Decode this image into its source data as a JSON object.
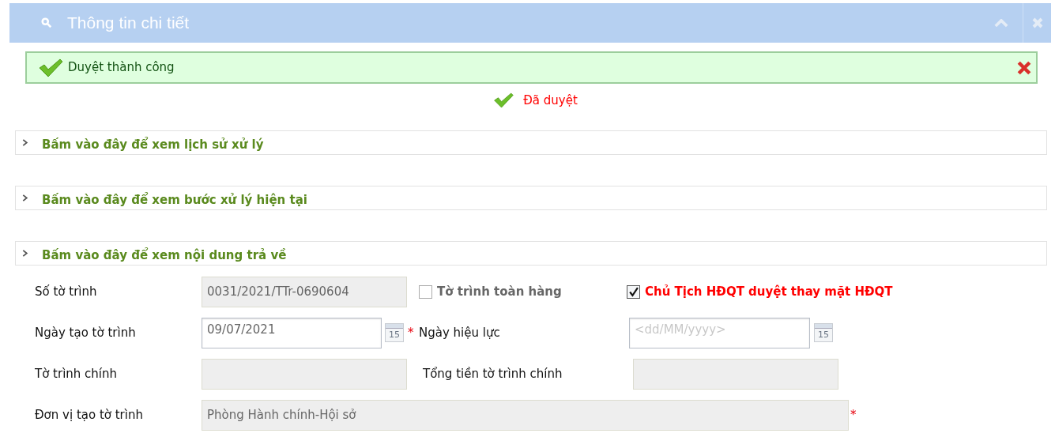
{
  "window": {
    "title": "Thông tin chi tiết"
  },
  "alert": {
    "kind": "success",
    "message": "Duyệt thành công"
  },
  "status": {
    "text": "Đã duyệt"
  },
  "sections": [
    {
      "label": "Bấm vào đây để xem lịch sử xử lý",
      "expanded": false
    },
    {
      "label": "Bấm vào đây để xem bước xử lý hiện tại",
      "expanded": false
    },
    {
      "label": "Bấm vào đây để xem nội dung trả về",
      "expanded": false
    }
  ],
  "form": {
    "so_to_trinh": {
      "label": "Số tờ trình",
      "value": "0031/2021/TTr-0690604",
      "disabled": true
    },
    "toan_hang": {
      "label": "Tờ trình toàn hàng",
      "checked": false
    },
    "chu_tich": {
      "label": "Chủ Tịch HĐQT duyệt thay mặt HĐQT",
      "checked": true
    },
    "ngay_tao": {
      "label": "Ngày tạo tờ trình",
      "value": "09/07/2021",
      "disabled": false,
      "required": true,
      "calendar_day": "15"
    },
    "ngay_hieu_luc": {
      "label": "Ngày hiệu lực",
      "placeholder": "<dd/MM/yyyy>",
      "disabled": false,
      "calendar_day": "15"
    },
    "to_trinh_chinh": {
      "label": "Tờ trình chính",
      "disabled": true
    },
    "tong_tien": {
      "label": "Tổng tiền tờ trình chính",
      "disabled": true
    },
    "don_vi": {
      "label": "Đơn vị tạo tờ trình",
      "value": "Phòng Hành chính-Hội sở",
      "disabled": true,
      "required": true
    }
  },
  "required_mark": "*"
}
